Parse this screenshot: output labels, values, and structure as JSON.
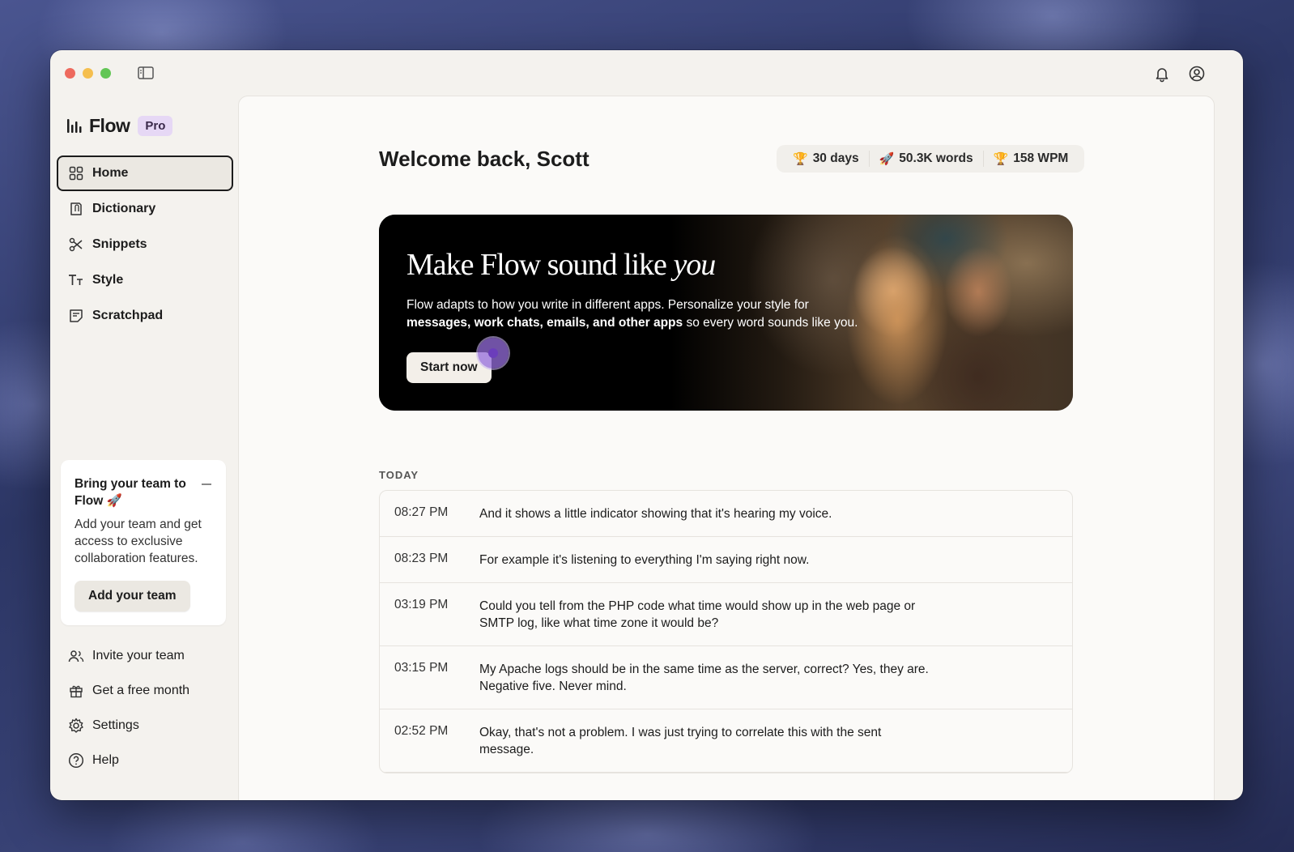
{
  "app": {
    "name": "Flow",
    "plan_badge": "Pro"
  },
  "nav": {
    "items": [
      {
        "label": "Home",
        "icon": "grid-icon",
        "active": true
      },
      {
        "label": "Dictionary",
        "icon": "book-icon"
      },
      {
        "label": "Snippets",
        "icon": "scissors-icon"
      },
      {
        "label": "Style",
        "icon": "text-style-icon"
      },
      {
        "label": "Scratchpad",
        "icon": "note-icon"
      }
    ],
    "bottom": [
      {
        "label": "Invite your team",
        "icon": "users-icon"
      },
      {
        "label": "Get a free month",
        "icon": "gift-icon"
      },
      {
        "label": "Settings",
        "icon": "gear-icon"
      },
      {
        "label": "Help",
        "icon": "help-icon"
      }
    ]
  },
  "promo": {
    "title": "Bring your team to Flow 🚀",
    "body": "Add your team and get access to exclusive collaboration features.",
    "button": "Add your team"
  },
  "header": {
    "welcome": "Welcome back, Scott",
    "stats": [
      {
        "emoji": "🏆",
        "label": "30 days"
      },
      {
        "emoji": "🚀",
        "label": "50.3K words"
      },
      {
        "emoji": "🏆",
        "label": "158 WPM"
      }
    ]
  },
  "banner": {
    "title": "Make Flow sound like",
    "title_italic": "you",
    "desc_plain": "Flow adapts to how you write in different apps. Personalize your style for",
    "desc_bold": "messages, work chats, emails, and other apps",
    "desc_tail": " so every word sounds like you.",
    "button": "Start now"
  },
  "history": {
    "section_label": "TODAY",
    "rows": [
      {
        "time": "08:27 PM",
        "text": "And it shows a little indicator showing that it's hearing my voice."
      },
      {
        "time": "08:23 PM",
        "text": "For example it's listening to everything I'm saying right now."
      },
      {
        "time": "03:19 PM",
        "text": "Could you tell from the PHP code what time would show up in the web page or SMTP log, like what time zone it would be?"
      },
      {
        "time": "03:15 PM",
        "text": "My Apache logs should be in the same time as the server, correct? Yes, they are. Negative five. Never mind."
      },
      {
        "time": "02:52 PM",
        "text": "Okay, that's not a problem. I was just trying to correlate this with the sent message."
      }
    ]
  }
}
